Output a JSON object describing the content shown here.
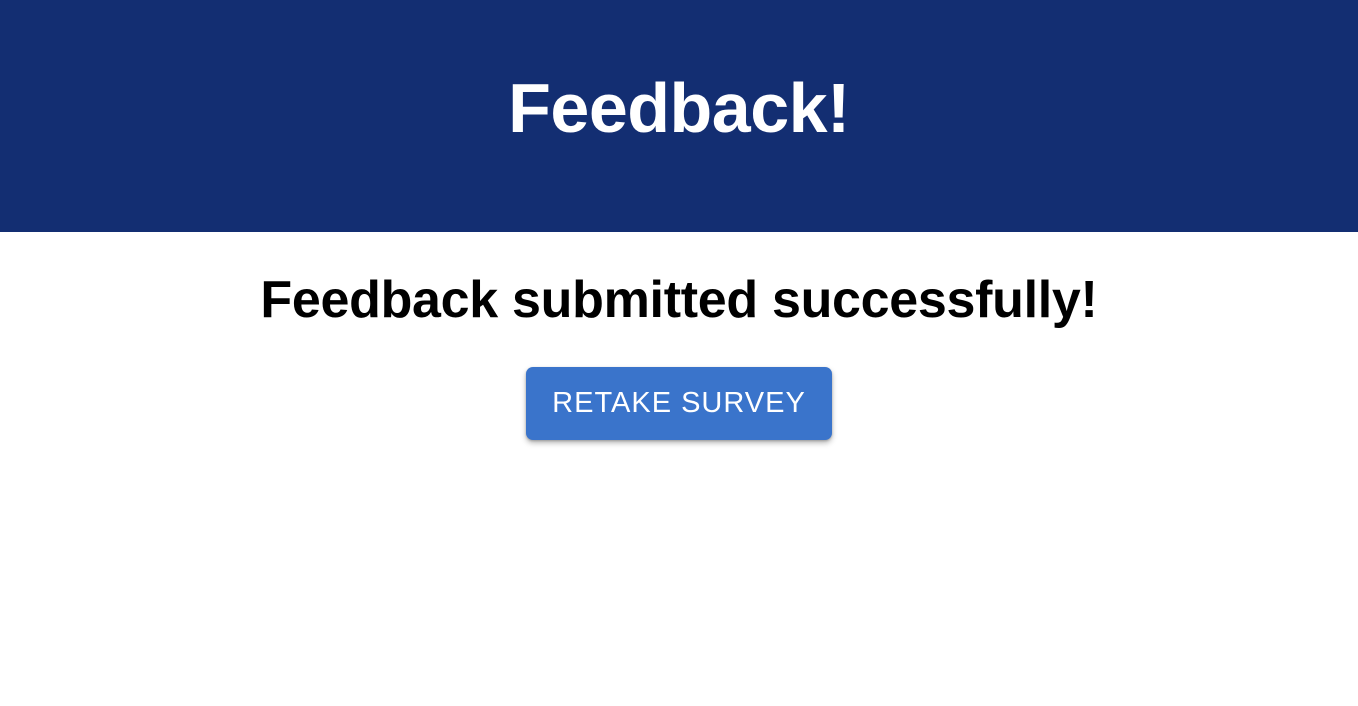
{
  "header": {
    "title": "Feedback!",
    "background_color": "#132e72"
  },
  "main": {
    "status_message": "Feedback submitted successfully!",
    "retake_button_label": "RETAKE SURVEY",
    "button_color": "#3a74cb"
  }
}
